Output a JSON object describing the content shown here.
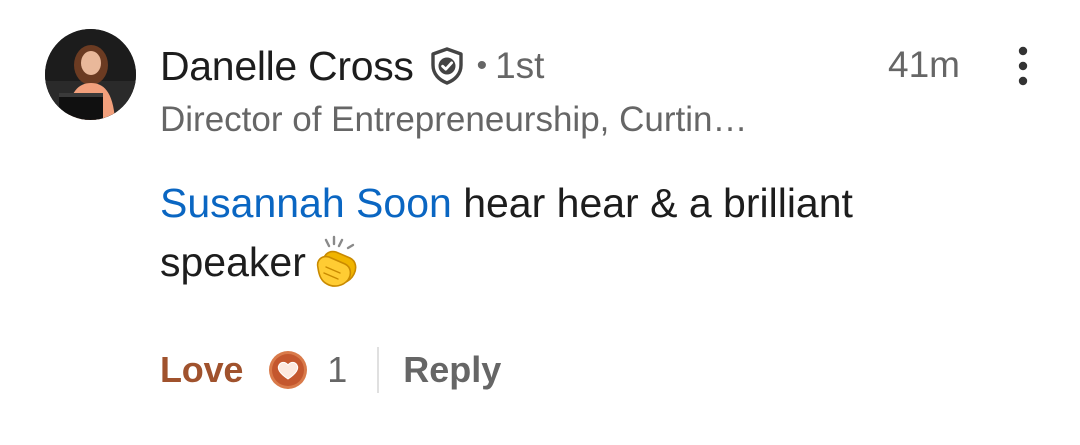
{
  "comment": {
    "author": {
      "name": "Danelle Cross",
      "connection_separator": "•",
      "connection_degree": "1st",
      "headline": "Director of Entrepreneurship, Curtin…",
      "verified_icon": "shield-check-icon"
    },
    "timestamp": "41m",
    "more_icon": "vertical-ellipsis-icon",
    "body": {
      "mention": "Susannah Soon",
      "text": " hear hear & a brilliant speaker",
      "emoji": "clapping-hands-icon"
    },
    "actions": {
      "love_label": "Love",
      "reaction_icon": "heart-reaction-icon",
      "reaction_count": "1",
      "reply_label": "Reply"
    }
  },
  "colors": {
    "mention": "#0a66c2",
    "love": "#a0522d",
    "secondary_text": "#666666",
    "primary_text": "#1d1d1d"
  }
}
